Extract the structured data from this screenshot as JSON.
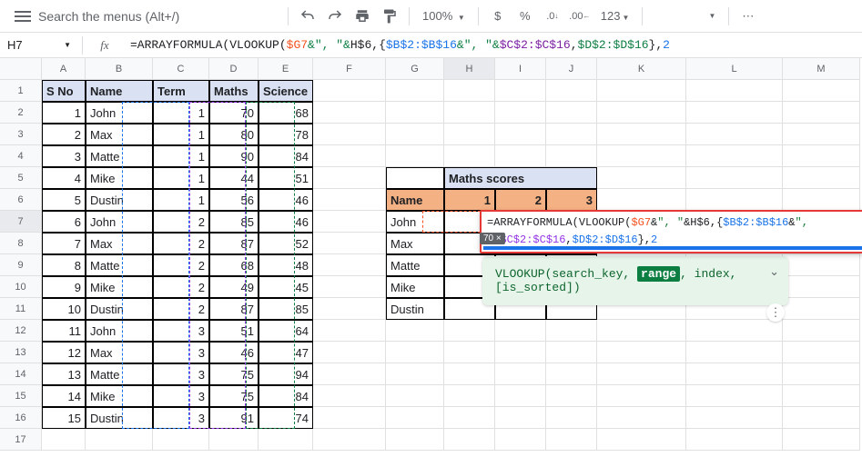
{
  "toolbar": {
    "search_placeholder": "Search the menus (Alt+/)",
    "zoom": "100%",
    "currency": "$",
    "percent": "%",
    "dec_decrease": ".0",
    "dec_increase": ".00",
    "format": "123",
    "more": "⋯"
  },
  "formula_bar": {
    "cell": "H7",
    "fx": "fx",
    "formula_prefix": "=ARRAYFORMULA(VLOOKUP(",
    "ref_g7": "$G7",
    "amp1": "&\", \"&",
    "ref_h6": "H$6",
    "comma_open": ",{",
    "ref_b": "$B$2:$B$16",
    "amp2": "&\", \"&",
    "ref_c": "$C$2:$C$16",
    "comma2": ",",
    "ref_d": "$D$2:$D$16",
    "close": "},",
    "num": "2"
  },
  "columns": [
    "A",
    "B",
    "C",
    "D",
    "E",
    "F",
    "G",
    "H",
    "I",
    "J",
    "K",
    "L",
    "M"
  ],
  "table": {
    "headers": {
      "sno": "S No",
      "name": "Name",
      "term": "Term",
      "maths": "Maths",
      "science": "Science"
    },
    "rows": [
      {
        "sno": "1",
        "name": "John",
        "term": "1",
        "maths": "70",
        "science": "68"
      },
      {
        "sno": "2",
        "name": "Max",
        "term": "1",
        "maths": "80",
        "science": "78"
      },
      {
        "sno": "3",
        "name": "Matte",
        "term": "1",
        "maths": "90",
        "science": "84"
      },
      {
        "sno": "4",
        "name": "Mike",
        "term": "1",
        "maths": "44",
        "science": "51"
      },
      {
        "sno": "5",
        "name": "Dustin",
        "term": "1",
        "maths": "56",
        "science": "46"
      },
      {
        "sno": "6",
        "name": "John",
        "term": "2",
        "maths": "85",
        "science": "46"
      },
      {
        "sno": "7",
        "name": "Max",
        "term": "2",
        "maths": "87",
        "science": "52"
      },
      {
        "sno": "8",
        "name": "Matte",
        "term": "2",
        "maths": "68",
        "science": "48"
      },
      {
        "sno": "9",
        "name": "Mike",
        "term": "2",
        "maths": "49",
        "science": "45"
      },
      {
        "sno": "10",
        "name": "Dustin",
        "term": "2",
        "maths": "87",
        "science": "85"
      },
      {
        "sno": "11",
        "name": "John",
        "term": "3",
        "maths": "51",
        "science": "64"
      },
      {
        "sno": "12",
        "name": "Max",
        "term": "3",
        "maths": "46",
        "science": "47"
      },
      {
        "sno": "13",
        "name": "Matte",
        "term": "3",
        "maths": "75",
        "science": "94"
      },
      {
        "sno": "14",
        "name": "Mike",
        "term": "3",
        "maths": "75",
        "science": "84"
      },
      {
        "sno": "15",
        "name": "Dustin",
        "term": "3",
        "maths": "91",
        "science": "74"
      }
    ]
  },
  "side": {
    "title": "Maths scores",
    "name_label": "Name",
    "cols": [
      "1",
      "2",
      "3"
    ],
    "names": [
      "John",
      "Max",
      "Matte",
      "Mike",
      "Dustin"
    ],
    "hint": "70 ×"
  },
  "tooltip": {
    "line1_a": "=ARRAYFORMULA(VLOOKUP(",
    "g7": "$G7",
    "amp": "&",
    "str": "\", \"",
    "h6": "H$6",
    "c1": ",{",
    "b": "$B$2:$B$16",
    "c": "$C$2:$C$16",
    "c2": ",",
    "d": "$D$2:$D$16",
    "end": "},",
    "two": "2"
  },
  "help": {
    "fn": "VLOOKUP(",
    "p1": "search_key, ",
    "range": "range",
    "p2": ", index, ",
    "p3": "[is_sorted])"
  }
}
